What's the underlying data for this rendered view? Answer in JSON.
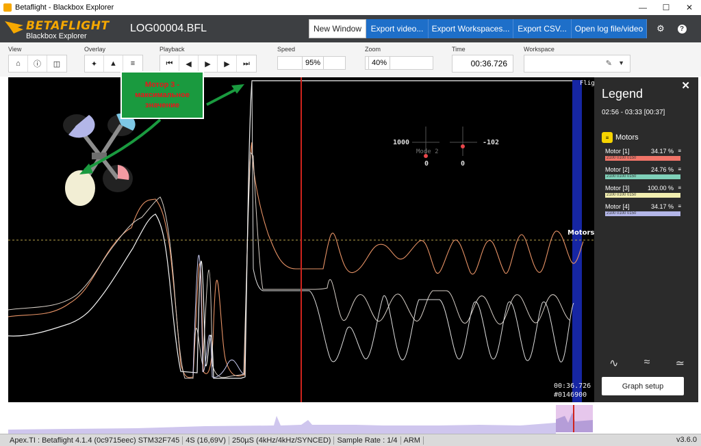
{
  "window": {
    "title": "Betaflight - Blackbox Explorer"
  },
  "header": {
    "brand_name": "BETAFLIGHT",
    "brand_sub": "Blackbox Explorer",
    "log_name": "LOG00004.BFL",
    "buttons": [
      "New Window",
      "Export video...",
      "Export Workspaces...",
      "Export CSV...",
      "Open log file/video"
    ]
  },
  "toolbar": {
    "view_label": "View",
    "overlay_label": "Overlay",
    "playback_label": "Playback",
    "speed_label": "Speed",
    "speed_value": "95%",
    "zoom_label": "Zoom",
    "zoom_value": "40%",
    "time_label": "Time",
    "time_value": "00:36.726",
    "workspace_label": "Workspace"
  },
  "graph": {
    "stick_left_value": "1000",
    "stick_right_value": "-102",
    "stick_mode_label": "Mode 2",
    "stick_left_bottom": "0",
    "stick_right_bottom": "0",
    "motors_label": "Motors",
    "flags_label": "Fligh",
    "time_overlay": "00:36.726",
    "frame_overlay": "#0146900",
    "annotation_text": "Мотор 3 - максимальное значение"
  },
  "legend": {
    "title": "Legend",
    "range": "02:56 - 03:33 [00:37]",
    "group_name": "Motors",
    "group_icon": "≡",
    "items": [
      {
        "name": "Motor [1]",
        "pct": "34.17 %",
        "color": "#f07468",
        "bar_text": "2100 0100 0150"
      },
      {
        "name": "Motor [2]",
        "pct": "24.76 %",
        "color": "#7fd1b9",
        "bar_text": "2100 0100 0150"
      },
      {
        "name": "Motor [3]",
        "pct": "100.00 %",
        "color": "#f2eeb0",
        "bar_text": "2100 0100 0150"
      },
      {
        "name": "Motor [4]",
        "pct": "34.17 %",
        "color": "#b3b6e8",
        "bar_text": "2100 0100 0150"
      }
    ],
    "setup_button": "Graph setup"
  },
  "status": {
    "items": [
      "Apex.TI : Betaflight 4.1.4 (0c9715eec) STM32F745",
      "4S (16,69V)",
      "250µS (4kHz/4kHz/SYNCED)",
      "Sample Rate : 1/4",
      "ARM"
    ],
    "version": "v3.6.0"
  },
  "colors": {
    "accent": "#1e6fc9",
    "brand": "#f6a800",
    "cursor": "#d0231d",
    "flags_band": "#1a2dbf"
  }
}
